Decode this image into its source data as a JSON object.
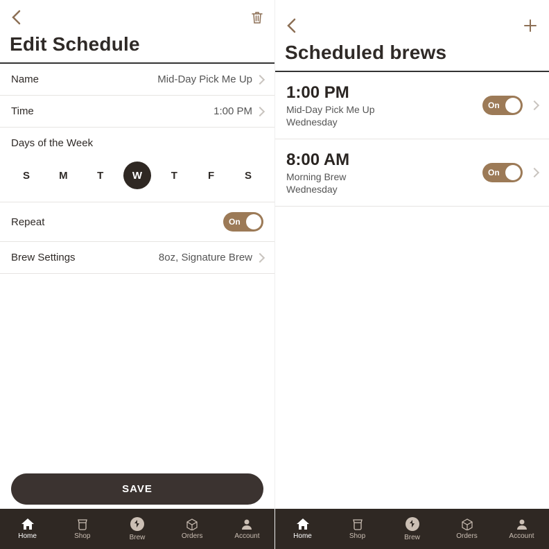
{
  "colors": {
    "accent": "#9c7a57",
    "dark": "#2f2823",
    "text": "#2f2a27"
  },
  "left": {
    "title": "Edit Schedule",
    "rows": {
      "name": {
        "label": "Name",
        "value": "Mid-Day Pick Me Up"
      },
      "time": {
        "label": "Time",
        "value": "1:00 PM"
      },
      "repeat": {
        "label": "Repeat",
        "toggle": "On"
      },
      "brew": {
        "label": "Brew Settings",
        "value": "8oz, Signature Brew"
      }
    },
    "days": {
      "label": "Days of the Week",
      "items": [
        "S",
        "M",
        "T",
        "W",
        "T",
        "F",
        "S"
      ],
      "selected_index": 3
    },
    "save": "SAVE"
  },
  "right": {
    "title": "Scheduled brews",
    "items": [
      {
        "time": "1:00 PM",
        "name": "Mid-Day Pick Me Up",
        "day": "Wednesday",
        "toggle": "On"
      },
      {
        "time": "8:00 AM",
        "name": "Morning Brew",
        "day": "Wednesday",
        "toggle": "On"
      }
    ]
  },
  "tabs": [
    {
      "label": "Home",
      "active": true
    },
    {
      "label": "Shop",
      "active": false
    },
    {
      "label": "Brew",
      "active": false
    },
    {
      "label": "Orders",
      "active": false
    },
    {
      "label": "Account",
      "active": false
    }
  ]
}
